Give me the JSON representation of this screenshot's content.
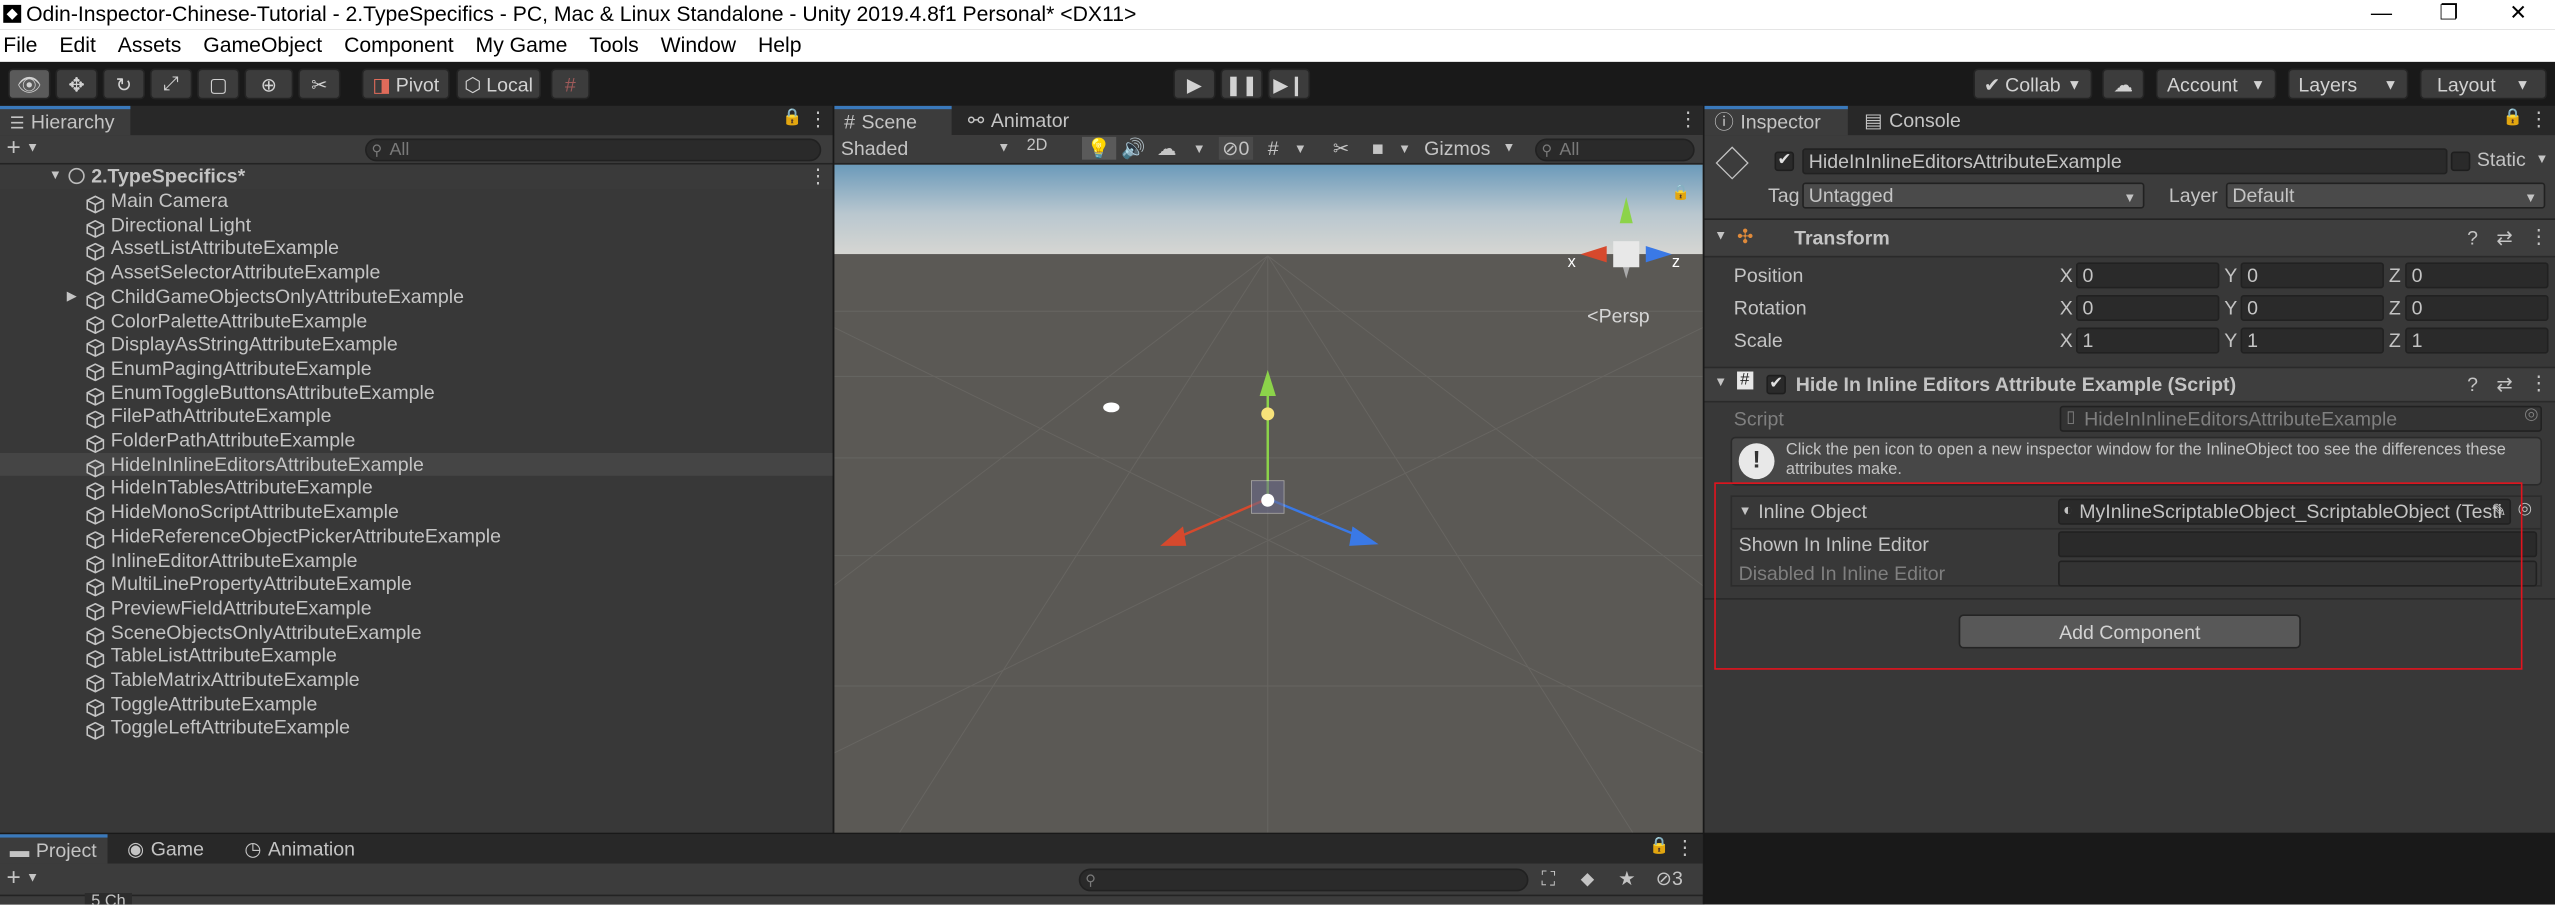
{
  "window": {
    "title": "Odin-Inspector-Chinese-Tutorial - 2.TypeSpecifics - PC, Mac & Linux Standalone - Unity 2019.4.8f1 Personal* <DX11>",
    "controls": [
      "—",
      "❐",
      "✕"
    ]
  },
  "menu": [
    "File",
    "Edit",
    "Assets",
    "GameObject",
    "Component",
    "My Game",
    "Tools",
    "Window",
    "Help"
  ],
  "toolbar": {
    "pivot": "Pivot",
    "local": "Local",
    "collab": "Collab",
    "account": "Account",
    "layers": "Layers",
    "layout": "Layout"
  },
  "hierarchy": {
    "tab": "Hierarchy",
    "search_placeholder": "All",
    "scene_name": "2.TypeSpecifics*",
    "selected_index": 11,
    "items": [
      {
        "label": "Main Camera",
        "expandable": false
      },
      {
        "label": "Directional Light",
        "expandable": false
      },
      {
        "label": "AssetListAttributeExample",
        "expandable": false
      },
      {
        "label": "AssetSelectorAttributeExample",
        "expandable": false
      },
      {
        "label": "ChildGameObjectsOnlyAttributeExample",
        "expandable": true
      },
      {
        "label": "ColorPaletteAttributeExample",
        "expandable": false
      },
      {
        "label": "DisplayAsStringAttributeExample",
        "expandable": false
      },
      {
        "label": "EnumPagingAttributeExample",
        "expandable": false
      },
      {
        "label": "EnumToggleButtonsAttributeExample",
        "expandable": false
      },
      {
        "label": "FilePathAttributeExample",
        "expandable": false
      },
      {
        "label": "FolderPathAttributeExample",
        "expandable": false
      },
      {
        "label": "HideInInlineEditorsAttributeExample",
        "expandable": false
      },
      {
        "label": "HideInTablesAttributeExample",
        "expandable": false
      },
      {
        "label": "HideMonoScriptAttributeExample",
        "expandable": false
      },
      {
        "label": "HideReferenceObjectPickerAttributeExample",
        "expandable": false
      },
      {
        "label": "InlineEditorAttributeExample",
        "expandable": false
      },
      {
        "label": "MultiLinePropertyAttributeExample",
        "expandable": false
      },
      {
        "label": "PreviewFieldAttributeExample",
        "expandable": false
      },
      {
        "label": "SceneObjectsOnlyAttributeExample",
        "expandable": false
      },
      {
        "label": "TableListAttributeExample",
        "expandable": false
      },
      {
        "label": "TableMatrixAttributeExample",
        "expandable": false
      },
      {
        "label": "ToggleAttributeExample",
        "expandable": false
      },
      {
        "label": "ToggleLeftAttributeExample",
        "expandable": false
      }
    ]
  },
  "scene": {
    "tabs": [
      "Scene",
      "Animator"
    ],
    "shading": "Shaded",
    "mode_2d": "2D",
    "gizmos": "Gizmos",
    "search_placeholder": "All",
    "persp": "Persp",
    "gizmo_axes": {
      "x": "x",
      "z": "z"
    },
    "hidden_count": "0"
  },
  "inspector": {
    "tabs": [
      "Inspector",
      "Console"
    ],
    "object_name": "HideInInlineEditorsAttributeExample",
    "static_label": "Static",
    "tag_label": "Tag",
    "tag_value": "Untagged",
    "layer_label": "Layer",
    "layer_value": "Default",
    "transform": {
      "title": "Transform",
      "rows": [
        {
          "label": "Position",
          "x": "0",
          "y": "0",
          "z": "0"
        },
        {
          "label": "Rotation",
          "x": "0",
          "y": "0",
          "z": "0"
        },
        {
          "label": "Scale",
          "x": "1",
          "y": "1",
          "z": "1"
        }
      ],
      "axis_labels": [
        "X",
        "Y",
        "Z"
      ]
    },
    "component": {
      "title": "Hide In Inline Editors Attribute Example (Script)",
      "script_label": "Script",
      "script_value": "HideInInlineEditorsAttributeExample",
      "info": "Click the pen icon to open a new inspector window for the InlineObject too see the differences these attributes make.",
      "inline_object_label": "Inline Object",
      "inline_object_value": "MyInlineScriptableObject_ScriptableObject (Testi",
      "shown_label": "Shown In Inline Editor",
      "disabled_label": "Disabled In Inline Editor"
    },
    "add_component": "Add Component"
  },
  "bottom": {
    "tabs": [
      "Project",
      "Game",
      "Animation"
    ],
    "layer_count": "3",
    "folder_partial": "5 Ch"
  },
  "colors": {
    "accent": "#3a79bb",
    "highlight_box": "#e0141e"
  }
}
